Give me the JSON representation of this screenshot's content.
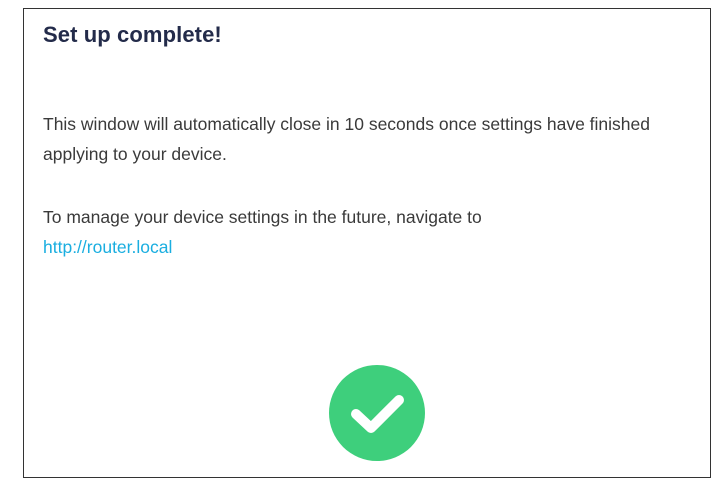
{
  "dialog": {
    "title": "Set up complete!",
    "message_1": "This window will automatically close in 10 seconds once settings have finished applying to your device.",
    "message_2_prefix": "To manage your device settings in the future, navigate to",
    "router_link": "http://router.local",
    "success_icon": "check-circle-icon"
  },
  "colors": {
    "title": "#232b4a",
    "body_text": "#3a3a3a",
    "link": "#1aaee0",
    "success": "#3ecf7c"
  }
}
